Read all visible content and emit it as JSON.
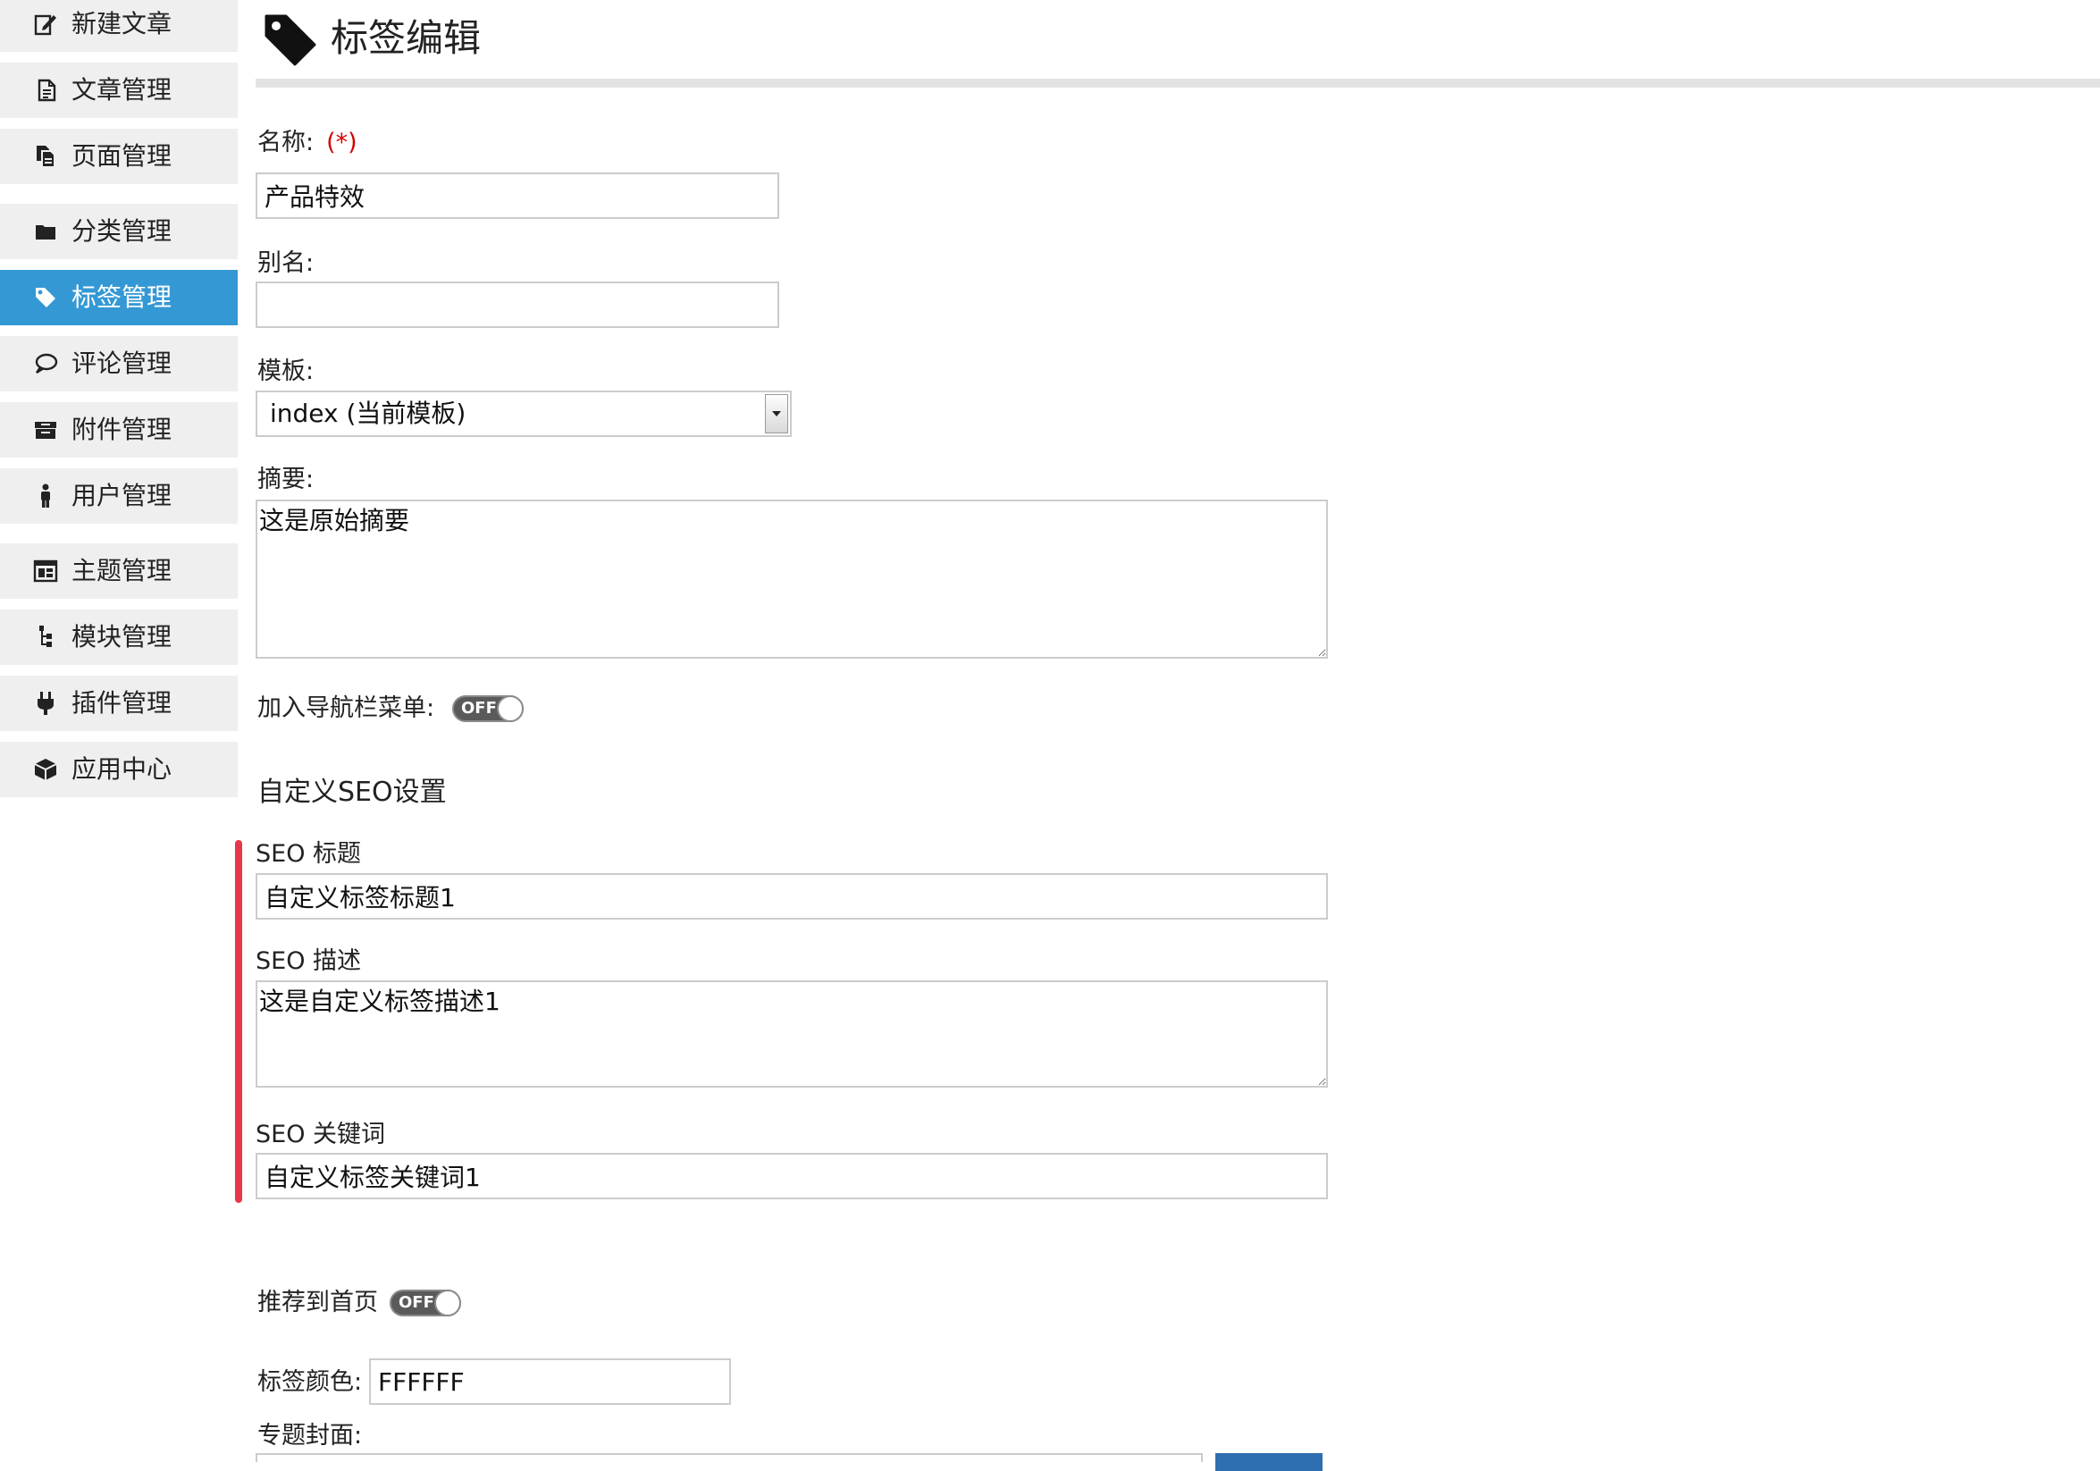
{
  "sidebar": {
    "items": [
      {
        "label": "新建文章",
        "icon": "edit-icon"
      },
      {
        "label": "文章管理",
        "icon": "document-icon"
      },
      {
        "label": "页面管理",
        "icon": "pages-icon"
      },
      {
        "label": "分类管理",
        "icon": "folder-icon"
      },
      {
        "label": "标签管理",
        "icon": "tag-icon",
        "active": true
      },
      {
        "label": "评论管理",
        "icon": "comment-icon"
      },
      {
        "label": "附件管理",
        "icon": "archive-icon"
      },
      {
        "label": "用户管理",
        "icon": "user-icon"
      },
      {
        "label": "主题管理",
        "icon": "layout-icon"
      },
      {
        "label": "模块管理",
        "icon": "tree-icon"
      },
      {
        "label": "插件管理",
        "icon": "plug-icon"
      },
      {
        "label": "应用中心",
        "icon": "cube-icon"
      }
    ]
  },
  "header": {
    "title": "标签编辑",
    "icon": "tag-icon"
  },
  "form": {
    "name": {
      "label": "名称:",
      "required_mark": "(*)",
      "value": "产品特效"
    },
    "alias": {
      "label": "别名:",
      "value": ""
    },
    "template": {
      "label": "模板:",
      "selected": "index (当前模板)"
    },
    "summary": {
      "label": "摘要:",
      "value": "这是原始摘要"
    },
    "add_to_nav": {
      "label": "加入导航栏菜单:",
      "state": "OFF"
    },
    "seo_section_title": "自定义SEO设置",
    "seo_title": {
      "label": "SEO 标题",
      "value": "自定义标签标题1"
    },
    "seo_description": {
      "label": "SEO 描述",
      "value": "这是自定义标签描述1"
    },
    "seo_keywords": {
      "label": "SEO 关键词",
      "value": "自定义标签关键词1"
    },
    "recommend_home": {
      "label": "推荐到首页",
      "state": "OFF"
    },
    "tag_color": {
      "label": "标签颜色:",
      "value": "FFFFFF"
    },
    "topic_cover": {
      "label": "专题封面:"
    }
  },
  "colors": {
    "sidebar_active": "#3498d5",
    "sidebar_bg": "#efefef",
    "seo_accent": "#e8364a",
    "required": "#d40000",
    "upload_button": "#2d6fb0"
  }
}
